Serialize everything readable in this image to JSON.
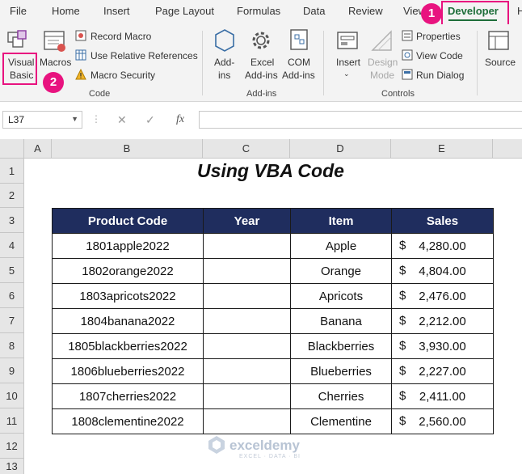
{
  "menu": [
    "File",
    "Home",
    "Insert",
    "Page Layout",
    "Formulas",
    "Data",
    "Review",
    "View",
    "Developer",
    "H"
  ],
  "ribbon": {
    "visual_basic": [
      "Visual",
      "Basic"
    ],
    "macros": "Macros",
    "record_macro": "Record Macro",
    "relative_refs": "Use Relative References",
    "macro_security": "Macro Security",
    "group_code": "Code",
    "addins": [
      "Add-",
      "ins"
    ],
    "excel_addins": [
      "Excel",
      "Add-ins"
    ],
    "com_addins": [
      "COM",
      "Add-ins"
    ],
    "group_addins": "Add-ins",
    "insert": "Insert",
    "design_mode": [
      "Design",
      "Mode"
    ],
    "properties": "Properties",
    "view_code": "View Code",
    "run_dialog": "Run Dialog",
    "group_controls": "Controls",
    "source": "Source"
  },
  "formula_bar": {
    "name_box": "L37",
    "fx": "fx",
    "cancel": "✕",
    "enter": "✓"
  },
  "columns": [
    "A",
    "B",
    "C",
    "D",
    "E"
  ],
  "rows": [
    "1",
    "2",
    "3",
    "4",
    "5",
    "6",
    "7",
    "8",
    "9",
    "10",
    "11",
    "12",
    "13"
  ],
  "sheet": {
    "title": "Using VBA Code",
    "headers": [
      "Product Code",
      "Year",
      "Item",
      "Sales"
    ],
    "currency": "$",
    "rows": [
      {
        "code": "1801apple2022",
        "year": "",
        "item": "Apple",
        "sales": "4,280.00"
      },
      {
        "code": "1802orange2022",
        "year": "",
        "item": "Orange",
        "sales": "4,804.00"
      },
      {
        "code": "1803apricots2022",
        "year": "",
        "item": "Apricots",
        "sales": "2,476.00"
      },
      {
        "code": "1804banana2022",
        "year": "",
        "item": "Banana",
        "sales": "2,212.00"
      },
      {
        "code": "1805blackberries2022",
        "year": "",
        "item": "Blackberries",
        "sales": "3,930.00"
      },
      {
        "code": "1806blueberries2022",
        "year": "",
        "item": "Blueberries",
        "sales": "2,227.00"
      },
      {
        "code": "1807cherries2022",
        "year": "",
        "item": "Cherries",
        "sales": "2,411.00"
      },
      {
        "code": "1808clementine2022",
        "year": "",
        "item": "Clementine",
        "sales": "2,560.00"
      }
    ]
  },
  "annotations": {
    "step1": "1",
    "step2": "2",
    "accent": "#e8137f",
    "header_fill": "#1f2d5e"
  },
  "watermark": {
    "name": "exceldemy",
    "tagline": "EXCEL · DATA · BI"
  }
}
